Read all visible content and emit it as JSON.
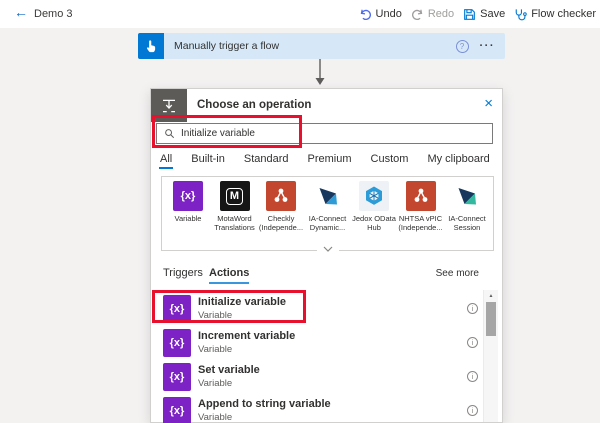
{
  "topbar": {
    "title": "Demo 3",
    "undo": "Undo",
    "redo": "Redo",
    "save": "Save",
    "flow_checker": "Flow checker"
  },
  "icons": {
    "back": "←",
    "close": "×",
    "more": "···",
    "help": "?",
    "info": "i",
    "scroll_up": "▲",
    "variable_glyph": "{x}",
    "motaword_glyph": "M"
  },
  "trigger_card": {
    "title": "Manually trigger a flow"
  },
  "dialog": {
    "title": "Choose an operation",
    "search": {
      "value": "Initialize variable"
    },
    "tabs": [
      {
        "label": "All"
      },
      {
        "label": "Built-in"
      },
      {
        "label": "Standard"
      },
      {
        "label": "Premium"
      },
      {
        "label": "Custom"
      },
      {
        "label": "My clipboard"
      }
    ],
    "selected_tab": "All",
    "connectors": [
      {
        "line1": "Variable",
        "line2": "",
        "color": "#7d22c4"
      },
      {
        "line1": "MotaWord",
        "line2": "Translations",
        "color": "#161616"
      },
      {
        "line1": "Checkly",
        "line2": "(Independe...",
        "color": "#c3472e"
      },
      {
        "line1": "IA-Connect",
        "line2": "Dynamic...",
        "color": ""
      },
      {
        "line1": "Jedox OData",
        "line2": "Hub",
        "color": "#eef2f6"
      },
      {
        "line1": "NHTSA vPIC",
        "line2": "(Independe...",
        "color": "#c3472e"
      },
      {
        "line1": "IA-Connect",
        "line2": "Session",
        "color": ""
      }
    ],
    "list_header": {
      "triggers": "Triggers",
      "actions": "Actions",
      "see_more": "See more"
    },
    "items": [
      {
        "title": "Initialize variable",
        "subtitle": "Variable",
        "highlighted": true
      },
      {
        "title": "Increment variable",
        "subtitle": "Variable",
        "highlighted": false
      },
      {
        "title": "Set variable",
        "subtitle": "Variable",
        "highlighted": false
      },
      {
        "title": "Append to string variable",
        "subtitle": "Variable",
        "highlighted": false
      }
    ]
  },
  "colors": {
    "accent": "#0078d4",
    "annotation_red": "#e8112d",
    "variable_purple": "#7d22c4",
    "independent_red": "#c3472e",
    "motaword_black": "#161616",
    "jedox_tile": "#eef2f6",
    "trigger_card_bg": "#d6e8f8",
    "actions_underline": "#3a96dd"
  }
}
